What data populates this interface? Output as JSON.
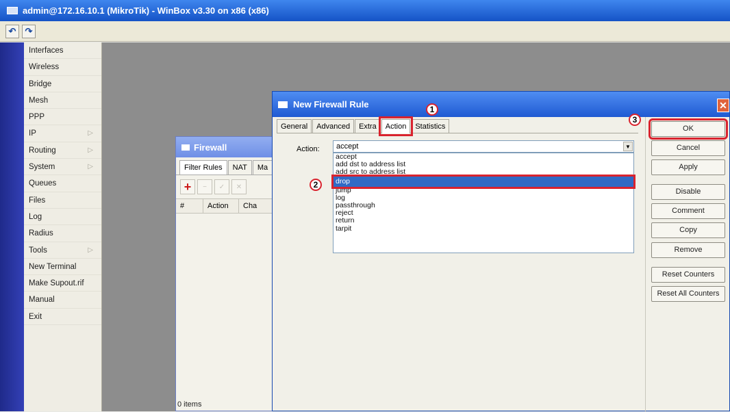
{
  "main_window": {
    "title": "admin@172.16.10.1 (MikroTik) - WinBox v3.30 on x86 (x86)",
    "toolbar": {
      "undo": "↶",
      "redo": "↷"
    }
  },
  "sidebar": {
    "items": [
      {
        "label": "Interfaces",
        "arrow": ""
      },
      {
        "label": "Wireless",
        "arrow": ""
      },
      {
        "label": "Bridge",
        "arrow": ""
      },
      {
        "label": "Mesh",
        "arrow": ""
      },
      {
        "label": "PPP",
        "arrow": ""
      },
      {
        "label": "IP",
        "arrow": "▷"
      },
      {
        "label": "Routing",
        "arrow": "▷"
      },
      {
        "label": "System",
        "arrow": "▷"
      },
      {
        "label": "Queues",
        "arrow": ""
      },
      {
        "label": "Files",
        "arrow": ""
      },
      {
        "label": "Log",
        "arrow": ""
      },
      {
        "label": "Radius",
        "arrow": ""
      },
      {
        "label": "Tools",
        "arrow": "▷"
      },
      {
        "label": "New Terminal",
        "arrow": ""
      },
      {
        "label": "Make Supout.rif",
        "arrow": ""
      },
      {
        "label": "Manual",
        "arrow": ""
      },
      {
        "label": "Exit",
        "arrow": ""
      }
    ]
  },
  "firewall_window": {
    "title": "Firewall",
    "tabs": [
      "Filter Rules",
      "NAT",
      "Ma"
    ],
    "columns": [
      "#",
      "Action",
      "Cha"
    ],
    "status": "0 items",
    "tools": {
      "add": "+",
      "remove": "−",
      "enable": "✓",
      "disable": "✕"
    }
  },
  "rule_dialog": {
    "title": "New Firewall Rule",
    "close": "✕",
    "tabs": [
      "General",
      "Advanced",
      "Extra",
      "Action",
      "Statistics"
    ],
    "active_tab": "Action",
    "action_label": "Action:",
    "action_value": "accept",
    "dropdown_arrow": "▼",
    "options": [
      "accept",
      "add dst to address list",
      "add src to address list",
      "drop",
      "jump",
      "log",
      "passthrough",
      "reject",
      "return",
      "tarpit"
    ],
    "selected_option": "drop",
    "buttons": {
      "ok": "OK",
      "cancel": "Cancel",
      "apply": "Apply",
      "disable": "Disable",
      "comment": "Comment",
      "copy": "Copy",
      "remove": "Remove",
      "reset_counters": "Reset Counters",
      "reset_all_counters": "Reset All Counters"
    }
  },
  "annotations": {
    "step1": "1",
    "step2": "2",
    "step3": "3"
  },
  "colors": {
    "highlight": "#d9232e",
    "selection": "#316ac5",
    "title_blue": "#1f5ad2"
  }
}
